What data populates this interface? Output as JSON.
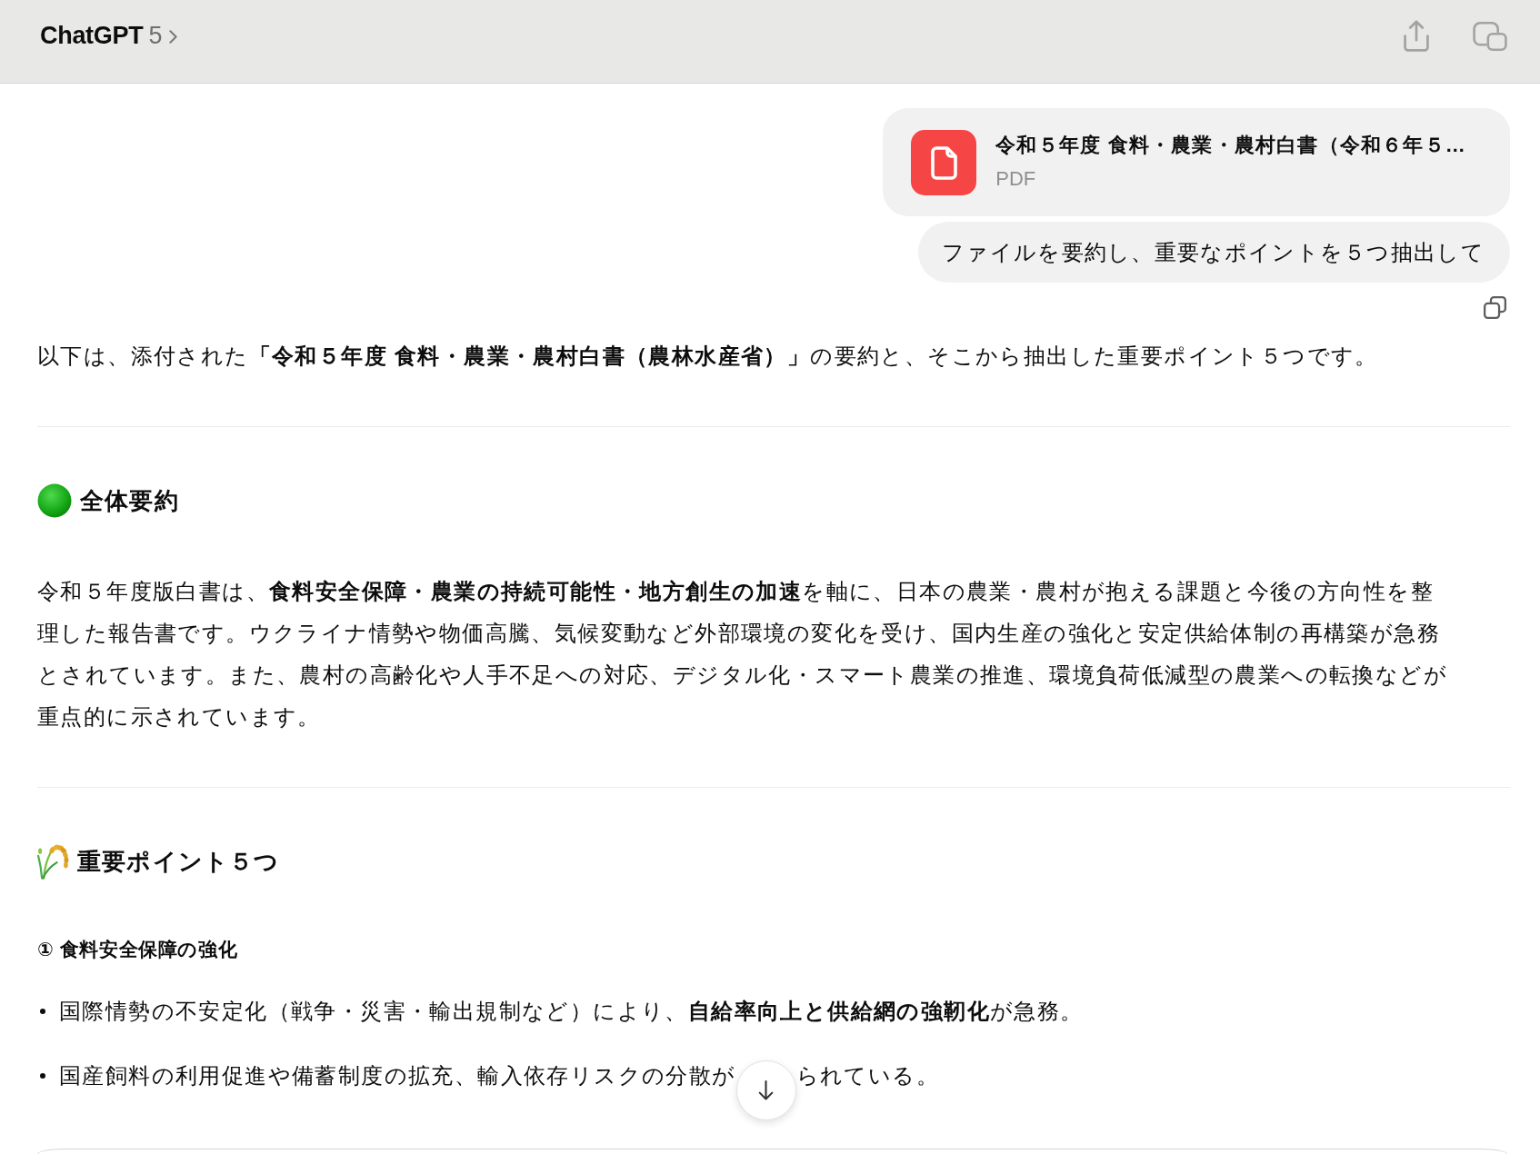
{
  "header": {
    "title": "ChatGPT",
    "model": "5"
  },
  "attachment": {
    "file_name": "令和５年度 食料・農業・農村白書（令和６年５…",
    "file_type": "PDF"
  },
  "user_message": "ファイルを要約し、重要なポイントを５つ抽出して",
  "response": {
    "intro": "以下は、添付された**「令和５年度 食料・農業・農村白書（農林水産省）」**の要約と、そこから抽出した重要ポイント５つです。",
    "sections": [
      {
        "heading": "全体要約",
        "blocks": [
          {
            "kind": "paragraph",
            "text": "令和５年度版白書は、**食料安全保障・農業の持続可能性・地方創生の加速**を軸に、日本の農業・農村が抱える課題と今後の方向性を整理した報告書です。ウクライナ情勢や物価高騰、気候変動など外部環境の変化を受け、国内生産の強化と安定供給体制の再構築が急務とされています。また、農村の高齢化や人手不足への対応、デジタル化・スマート農業の推進、環境負荷低減型の農業への転換などが重点的に示されています。"
          }
        ]
      },
      {
        "heading": "重要ポイント５つ",
        "blocks": [
          {
            "kind": "subheading",
            "text": "① 食料安全保障の強化"
          },
          {
            "kind": "bullets",
            "items": [
              {
                "segments": [
                  "国際情勢の不安定化（戦争・災害・輸出規制など）により、**自給率向上と供給網の強靭化**が急務。"
                ]
              },
              {
                "segments": [
                  "国産飼料の利用促進や備蓄制度の拡充、輸入依存リスクの分散が",
                  "られている。"
                ]
              }
            ]
          }
        ]
      }
    ]
  }
}
